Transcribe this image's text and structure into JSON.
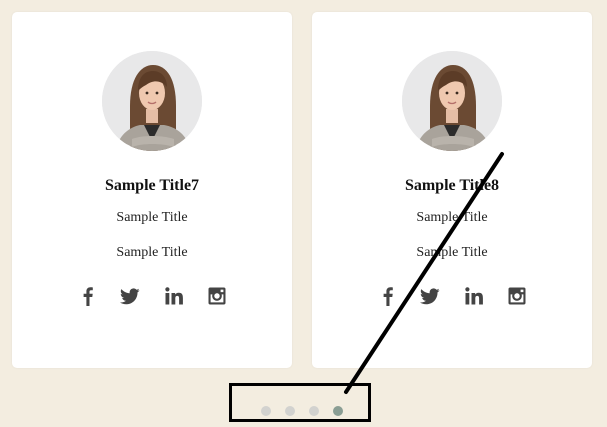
{
  "cards": [
    {
      "title": "Sample Title7",
      "subtitle_1": "Sample Title",
      "subtitle_2": "Sample Title"
    },
    {
      "title": "Sample Title8",
      "subtitle_1": "Sample Title",
      "subtitle_2": "Sample Title"
    }
  ],
  "social_icons": [
    "facebook-icon",
    "twitter-icon",
    "linkedin-icon",
    "instagram-icon"
  ],
  "pagination": {
    "total": 4,
    "active_index": 4
  },
  "colors": {
    "page_background": "#f3ede0",
    "card_background": "#ffffff",
    "icon": "#444444",
    "dot_inactive": "#d2d2cf",
    "dot_active": "#8a9e94",
    "annotation": "#000000"
  }
}
